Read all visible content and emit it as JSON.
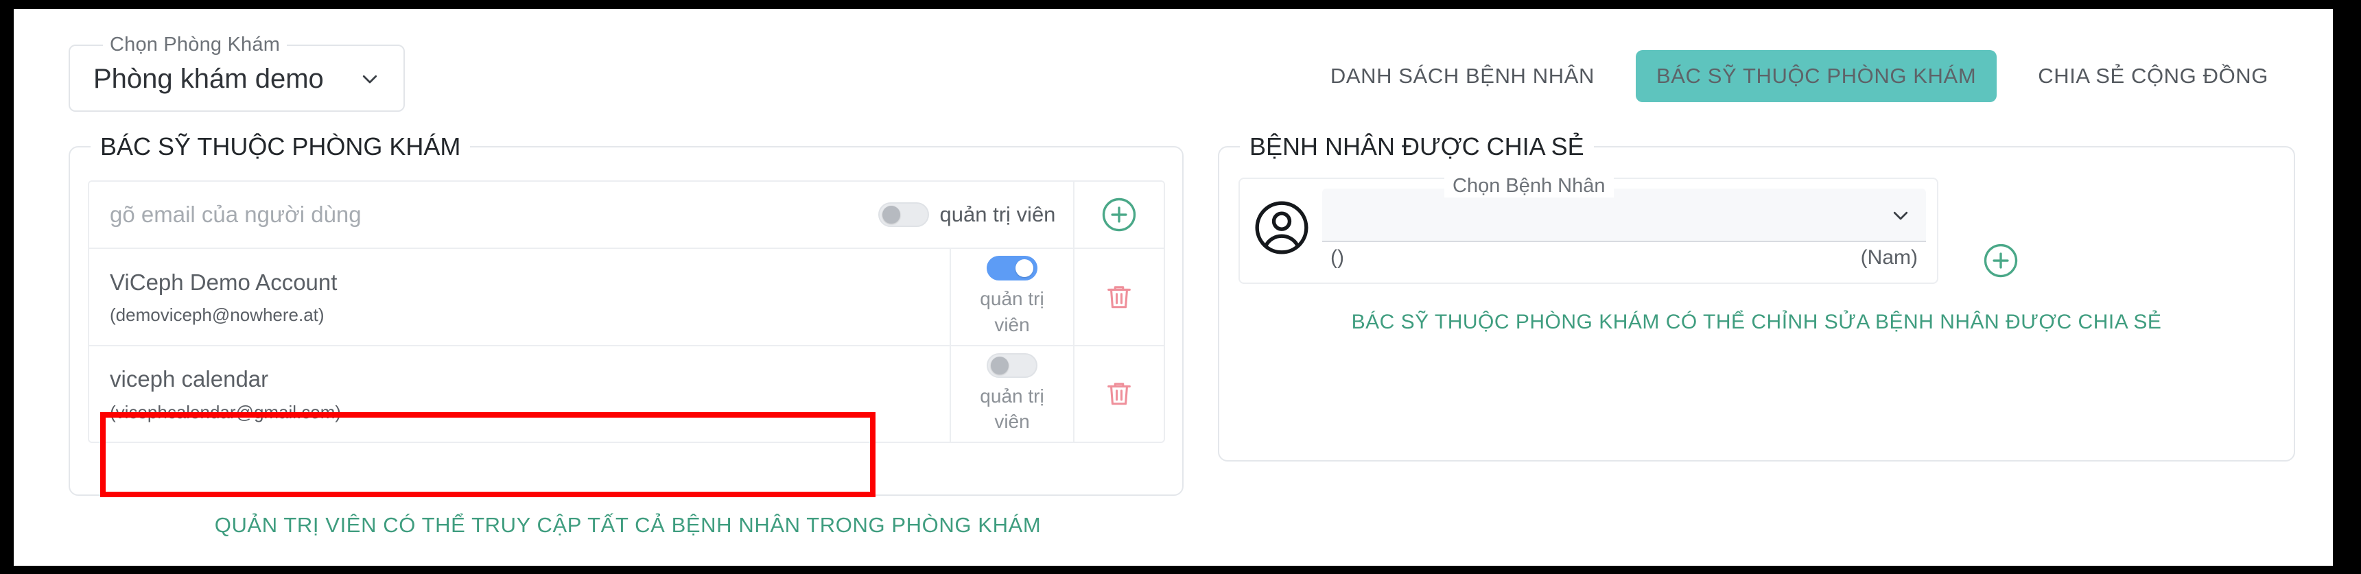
{
  "header": {
    "clinic_select": {
      "label": "Chọn Phòng Khám",
      "value": "Phòng khám demo",
      "chevron_icon": "chevron-down-icon"
    },
    "tabs": [
      {
        "label": "DANH SÁCH BỆNH NHÂN",
        "active": false
      },
      {
        "label": "BÁC SỸ THUỘC PHÒNG KHÁM",
        "active": true
      },
      {
        "label": "CHIA SẺ CỘNG ĐỒNG",
        "active": false
      }
    ]
  },
  "doctors_panel": {
    "legend": "BÁC SỸ THUỘC PHÒNG KHÁM",
    "add_row": {
      "email_placeholder": "gõ email của người dùng",
      "email_value": "",
      "admin_toggle_label": "quản trị viên",
      "admin_toggle_on": false,
      "add_icon": "plus-circle-icon"
    },
    "rows": [
      {
        "name": "ViCeph Demo Account",
        "email": "(demoviceph@nowhere.at)",
        "admin_toggle_label": "quản trị viên",
        "admin_toggle_on": true,
        "delete_icon": "trash-icon",
        "highlighted": false
      },
      {
        "name": "viceph calendar",
        "email": "(vicephcalendar@gmail.com)",
        "admin_toggle_label": "quản trị viên",
        "admin_toggle_on": false,
        "delete_icon": "trash-icon",
        "highlighted": true
      }
    ],
    "footer_note": "QUẢN TRỊ VIÊN CÓ THỂ TRUY CẬP TẤT CẢ BỆNH NHÂN TRONG PHÒNG KHÁM"
  },
  "shared_panel": {
    "legend": "BỆNH NHÂN ĐƯỢC CHIA SẺ",
    "patient_select": {
      "label": "Chọn Bệnh Nhân",
      "value": "",
      "chevron_icon": "chevron-down-icon",
      "avatar_icon": "user-avatar-icon"
    },
    "patient_meta_left": "()",
    "patient_meta_right": "(Nam)",
    "add_icon": "plus-circle-icon",
    "hint": "BÁC SỸ THUỘC PHÒNG KHÁM CÓ THỂ CHỈNH SỬA BỆNH NHÂN ĐƯỢC CHIA SẺ"
  },
  "colors": {
    "accent_teal": "#5ec4be",
    "hint_green": "#3f9d7f",
    "toggle_on_blue": "#5d9cf5",
    "delete_red": "#ef8f9a",
    "add_green": "#4aa888",
    "highlight_red": "#fd0000"
  }
}
